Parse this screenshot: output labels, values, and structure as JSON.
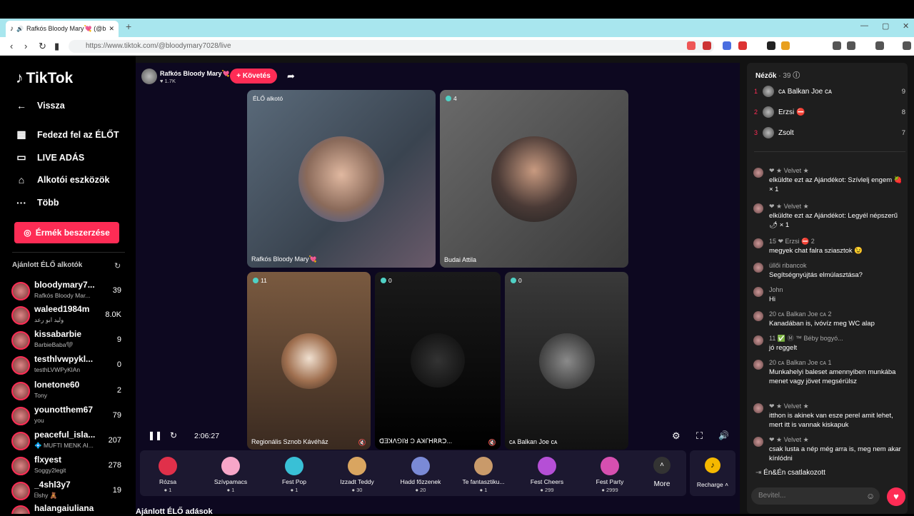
{
  "browser": {
    "tab_title": "Rafkós Bloody Mary💘 (@blo",
    "url": "https://www.tiktok.com/@bloodymary7028/live",
    "close": "✕",
    "newtab": "+"
  },
  "sidebar": {
    "logo": "TikTok",
    "items": [
      {
        "label": "Vissza",
        "icon": "arrow-left-icon"
      },
      {
        "label": "Fedezd fel az ÉLŐT",
        "icon": "calendar-icon"
      },
      {
        "label": "LIVE ADÁS",
        "icon": "camera-icon"
      },
      {
        "label": "Alkotói eszközök",
        "icon": "house-icon"
      },
      {
        "label": "Több",
        "icon": "dots-icon"
      }
    ],
    "coins_button": "Érmék beszerzése",
    "recommended_title": "Ajánlott ÉLŐ alkotók",
    "creators": [
      {
        "name": "bloodymary7...",
        "sub": "Rafkós Bloody Mar...",
        "count": "39"
      },
      {
        "name": "waleed1984m",
        "sub": "وليد ابو رعد",
        "count": "8.0K"
      },
      {
        "name": "kissabarbie",
        "sub": "BarbieBaba🖤",
        "count": "9"
      },
      {
        "name": "testhlvwpykl...",
        "sub": "testhLVWPyKlAn",
        "count": "0"
      },
      {
        "name": "lonetone60",
        "sub": "Tony",
        "count": "2"
      },
      {
        "name": "younotthem67",
        "sub": "you",
        "count": "79"
      },
      {
        "name": "peaceful_isla...",
        "sub": "💠 MUFTI MENK AI...",
        "count": "207"
      },
      {
        "name": "flxyest",
        "sub": "Soggy2legit",
        "count": "278"
      },
      {
        "name": "_4shl3y7",
        "sub": "ᗷshy 🧸",
        "count": "19"
      },
      {
        "name": "halangaiuliana",
        "sub": "",
        "count": ""
      }
    ]
  },
  "stage": {
    "host_name": "Rafkós Bloody Mary💘",
    "host_likes": "♥ 1.7K",
    "follow_label": "+ Követés",
    "tiles": [
      {
        "badge": "ÉLŐ alkotó",
        "label": "Rafkós Bloody Mary💘"
      },
      {
        "count": "4",
        "label": "Budai Attila"
      },
      {
        "count": "11",
        "label": "Regionális Sznob Kávéház"
      },
      {
        "count": "0",
        "label": "ꓷƎꓘꓥꓨꓲꓤ Ͻ ꓮꓘꓩꓧꓣꓣꓛ..."
      },
      {
        "count": "0",
        "label": "ᴄᴀ Balkan Joe ᴄᴀ"
      }
    ],
    "timer": "2:06:27"
  },
  "gifts": [
    {
      "name": "Rózsa",
      "price": "1",
      "color": "#e0304a"
    },
    {
      "name": "Szívpamacs",
      "price": "1",
      "color": "#f7a6c8"
    },
    {
      "name": "Fest Pop",
      "price": "1",
      "color": "#39c0d6"
    },
    {
      "name": "Izzadt Teddy",
      "price": "30",
      "color": "#d9a560"
    },
    {
      "name": "Hadd főzzenek",
      "price": "20",
      "color": "#7a8ad6"
    },
    {
      "name": "Te fantasztiku...",
      "price": "1",
      "color": "#c99a6a"
    },
    {
      "name": "Fest Cheers",
      "price": "299",
      "color": "#b54fd6"
    },
    {
      "name": "Fest Party",
      "price": "2999",
      "color": "#d64fb0"
    }
  ],
  "more_label": "More",
  "recharge_label": "Recharge",
  "chat": {
    "viewers_title": "Nézők",
    "viewers_count": "· 39",
    "top_viewers": [
      {
        "rank": "1",
        "name": "ᴄᴀ Balkan Joe ᴄᴀ",
        "count": "9"
      },
      {
        "rank": "2",
        "name": "Erzsi ⛔",
        "count": "8"
      },
      {
        "rank": "3",
        "name": "Zsolt",
        "count": "7"
      }
    ],
    "messages": [
      {
        "user": "❤ ★ Velvet ★",
        "text": "elküldte ezt az Ajándékot: Szívlelj engem 🍓 × 1"
      },
      {
        "user": "❤ ★ Velvet ★",
        "text": "elküldte ezt az Ajándékot: Legyél népszerű 🌶 × 1"
      },
      {
        "user": "15 ❤ Erzsi ⛔ 2",
        "text": "megyek chat falra sziasztok 😉"
      },
      {
        "user": "üllői ribancok",
        "text": "Segítségnyújtás elmúlasztása?"
      },
      {
        "user": "John",
        "text": "Hi"
      },
      {
        "user": "20 ᴄᴀ Balkan Joe ᴄᴀ 2",
        "text": "Kanadában is, ivóvíz meg WC alap"
      },
      {
        "user": "11 ✅ Ⓜ ™ Béby bogyó...",
        "text": "jó reggelt"
      },
      {
        "user": "20 ᴄᴀ Balkan Joe ᴄᴀ 1",
        "text": "Munkahelyi baleset amennyiben munkába menet vagy jövet megsérülsz"
      },
      {
        "user": "❤ ★ Velvet ★",
        "text": "itthon is akinek van esze perel amit lehet, mert itt is vannak kiskapuk"
      },
      {
        "user": "❤ ★ Velvet ★",
        "text": "csak lusta a nép még arra is, meg nem akar kínlódni"
      }
    ],
    "joined": "Én&Én  csatlakozott",
    "input_placeholder": "Bevitel..."
  },
  "bottom_heading": "Ajánlott ÉLŐ adások"
}
